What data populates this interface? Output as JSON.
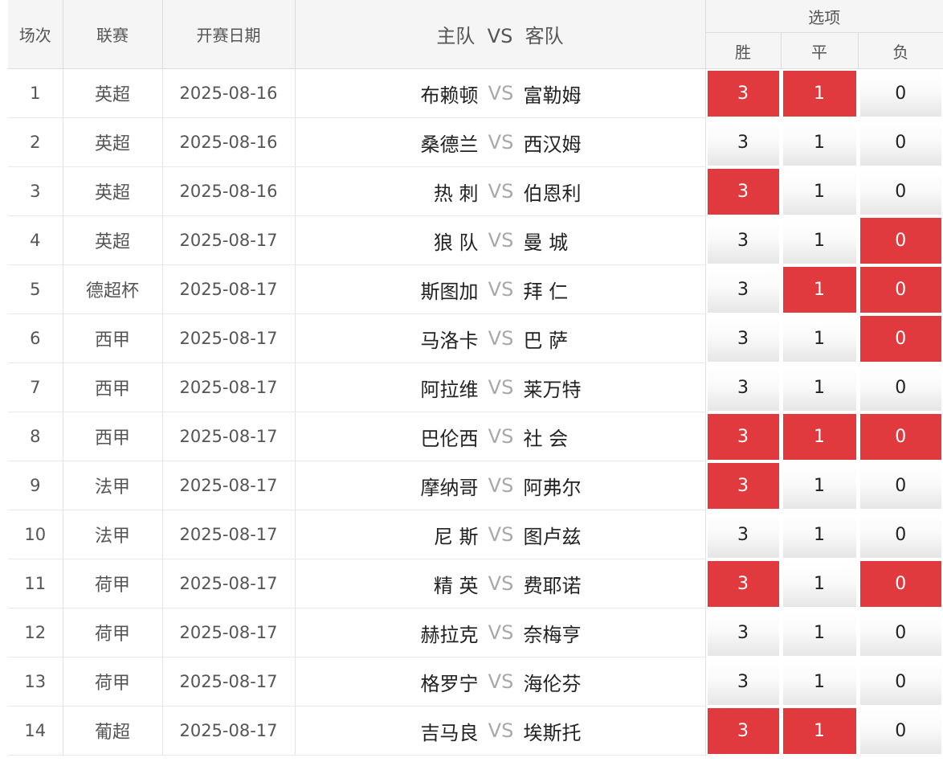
{
  "header": {
    "col_num": "场次",
    "col_league": "联赛",
    "col_date": "开赛日期",
    "col_home": "主队",
    "col_vs": "VS",
    "col_away": "客队",
    "col_options": "选项",
    "opt_win": "胜",
    "opt_draw": "平",
    "opt_loss": "负"
  },
  "rows": [
    {
      "num": "1",
      "league": "英超",
      "date": "2025-08-16",
      "home": "布赖顿",
      "vs": "VS",
      "away": "富勒姆",
      "win": "3",
      "draw": "1",
      "loss": "0",
      "sel": [
        true,
        true,
        false
      ]
    },
    {
      "num": "2",
      "league": "英超",
      "date": "2025-08-16",
      "home": "桑德兰",
      "vs": "VS",
      "away": "西汉姆",
      "win": "3",
      "draw": "1",
      "loss": "0",
      "sel": [
        false,
        false,
        false
      ]
    },
    {
      "num": "3",
      "league": "英超",
      "date": "2025-08-16",
      "home": "热 刺",
      "vs": "VS",
      "away": "伯恩利",
      "win": "3",
      "draw": "1",
      "loss": "0",
      "sel": [
        true,
        false,
        false
      ]
    },
    {
      "num": "4",
      "league": "英超",
      "date": "2025-08-17",
      "home": "狼 队",
      "vs": "VS",
      "away": "曼 城",
      "win": "3",
      "draw": "1",
      "loss": "0",
      "sel": [
        false,
        false,
        true
      ]
    },
    {
      "num": "5",
      "league": "德超杯",
      "date": "2025-08-17",
      "home": "斯图加",
      "vs": "VS",
      "away": "拜 仁",
      "win": "3",
      "draw": "1",
      "loss": "0",
      "sel": [
        false,
        true,
        true
      ]
    },
    {
      "num": "6",
      "league": "西甲",
      "date": "2025-08-17",
      "home": "马洛卡",
      "vs": "VS",
      "away": "巴 萨",
      "win": "3",
      "draw": "1",
      "loss": "0",
      "sel": [
        false,
        false,
        true
      ]
    },
    {
      "num": "7",
      "league": "西甲",
      "date": "2025-08-17",
      "home": "阿拉维",
      "vs": "VS",
      "away": "莱万特",
      "win": "3",
      "draw": "1",
      "loss": "0",
      "sel": [
        false,
        false,
        false
      ]
    },
    {
      "num": "8",
      "league": "西甲",
      "date": "2025-08-17",
      "home": "巴伦西",
      "vs": "VS",
      "away": "社 会",
      "win": "3",
      "draw": "1",
      "loss": "0",
      "sel": [
        true,
        true,
        true
      ]
    },
    {
      "num": "9",
      "league": "法甲",
      "date": "2025-08-17",
      "home": "摩纳哥",
      "vs": "VS",
      "away": "阿弗尔",
      "win": "3",
      "draw": "1",
      "loss": "0",
      "sel": [
        true,
        false,
        false
      ]
    },
    {
      "num": "10",
      "league": "法甲",
      "date": "2025-08-17",
      "home": "尼 斯",
      "vs": "VS",
      "away": "图卢兹",
      "win": "3",
      "draw": "1",
      "loss": "0",
      "sel": [
        false,
        false,
        false
      ]
    },
    {
      "num": "11",
      "league": "荷甲",
      "date": "2025-08-17",
      "home": "精 英",
      "vs": "VS",
      "away": "费耶诺",
      "win": "3",
      "draw": "1",
      "loss": "0",
      "sel": [
        true,
        false,
        true
      ]
    },
    {
      "num": "12",
      "league": "荷甲",
      "date": "2025-08-17",
      "home": "赫拉克",
      "vs": "VS",
      "away": "奈梅亨",
      "win": "3",
      "draw": "1",
      "loss": "0",
      "sel": [
        false,
        false,
        false
      ]
    },
    {
      "num": "13",
      "league": "荷甲",
      "date": "2025-08-17",
      "home": "格罗宁",
      "vs": "VS",
      "away": "海伦芬",
      "win": "3",
      "draw": "1",
      "loss": "0",
      "sel": [
        false,
        false,
        false
      ]
    },
    {
      "num": "14",
      "league": "葡超",
      "date": "2025-08-17",
      "home": "吉马良",
      "vs": "VS",
      "away": "埃斯托",
      "win": "3",
      "draw": "1",
      "loss": "0",
      "sel": [
        true,
        true,
        false
      ]
    }
  ],
  "colors": {
    "selected": "#e0393e",
    "header_bg": "#f5f5f5",
    "vs_text": "#a8a8a8"
  }
}
